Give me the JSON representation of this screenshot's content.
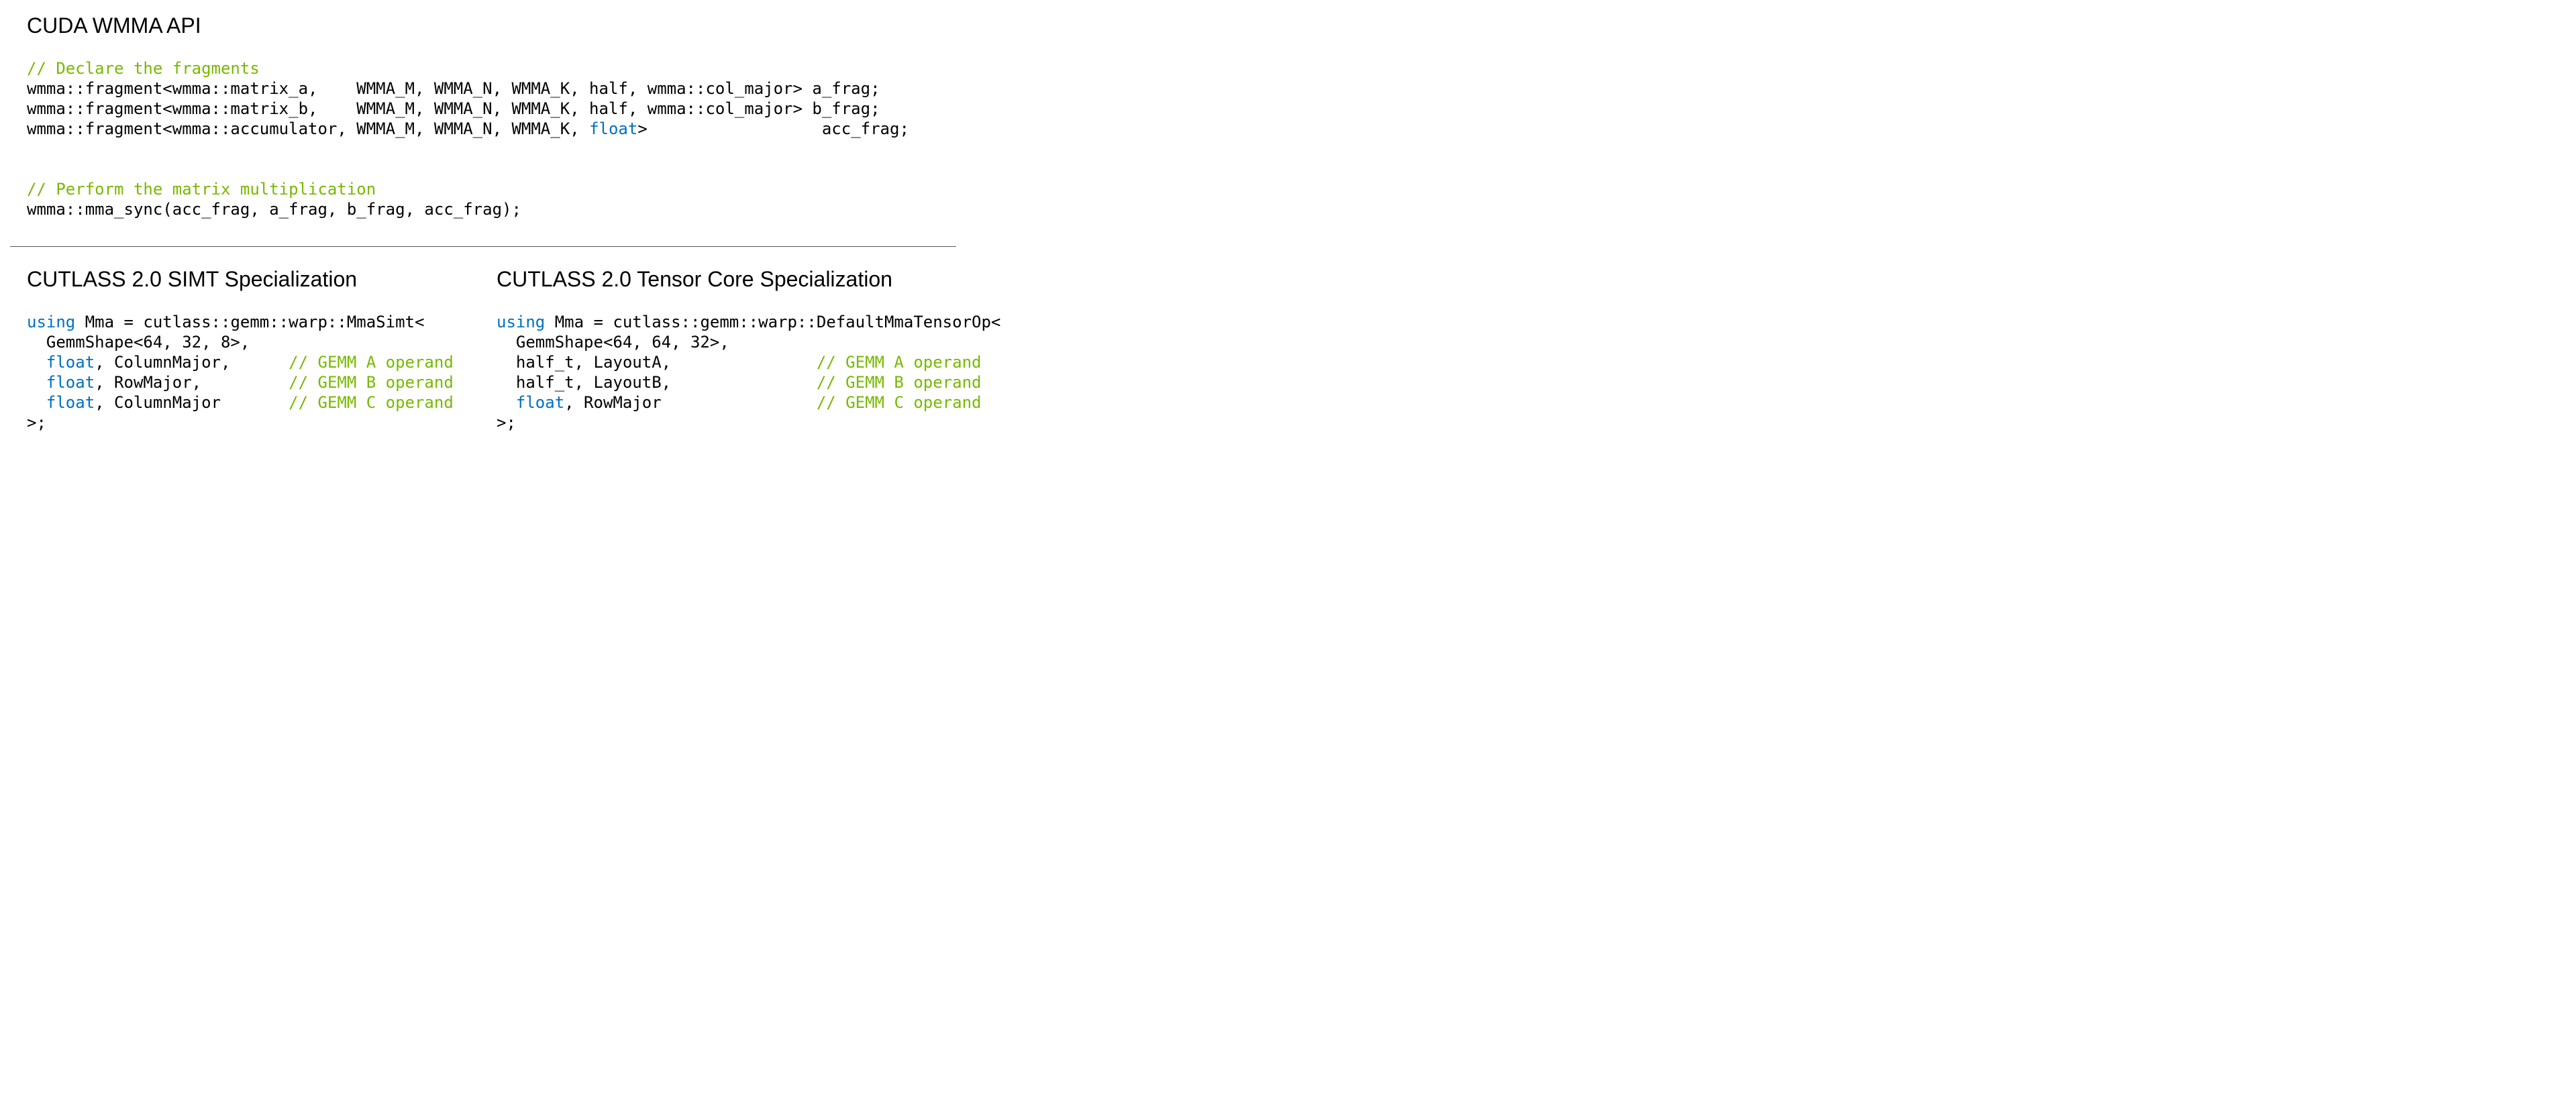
{
  "top": {
    "heading": "CUDA WMMA API",
    "code_html": "<span class='comment'>// Declare the fragments</span>\nwmma::fragment&lt;wmma::matrix_a,    WMMA_M, WMMA_N, WMMA_K, half, wmma::col_major&gt; a_frag;\nwmma::fragment&lt;wmma::matrix_b,    WMMA_M, WMMA_N, WMMA_K, half, wmma::col_major&gt; b_frag;\nwmma::fragment&lt;wmma::accumulator, WMMA_M, WMMA_N, WMMA_K, <span class='kw'>float</span>&gt;                  acc_frag;\n\n\n<span class='comment'>// Perform the matrix multiplication</span>\nwmma::mma_sync(acc_frag, a_frag, b_frag, acc_frag);"
  },
  "left": {
    "heading": "CUTLASS 2.0 SIMT Specialization",
    "code_html": "<span class='kw'>using</span> Mma = cutlass::gemm::warp::MmaSimt&lt;\n  GemmShape&lt;64, 32, 8&gt;,\n  <span class='kw'>float</span>, ColumnMajor,      <span class='comment'>// GEMM A operand</span>\n  <span class='kw'>float</span>, RowMajor,         <span class='comment'>// GEMM B operand</span>\n  <span class='kw'>float</span>, ColumnMajor       <span class='comment'>// GEMM C operand</span>\n&gt;;"
  },
  "right": {
    "heading": "CUTLASS 2.0 Tensor Core Specialization",
    "code_html": "<span class='kw'>using</span> Mma = cutlass::gemm::warp::DefaultMmaTensorOp&lt;\n  GemmShape&lt;64, 64, 32&gt;,\n  half_t, LayoutA,               <span class='comment'>// GEMM A operand</span>\n  half_t, LayoutB,               <span class='comment'>// GEMM B operand</span>\n  <span class='kw'>float</span>, RowMajor                <span class='comment'>// GEMM C operand</span>\n&gt;;"
  }
}
